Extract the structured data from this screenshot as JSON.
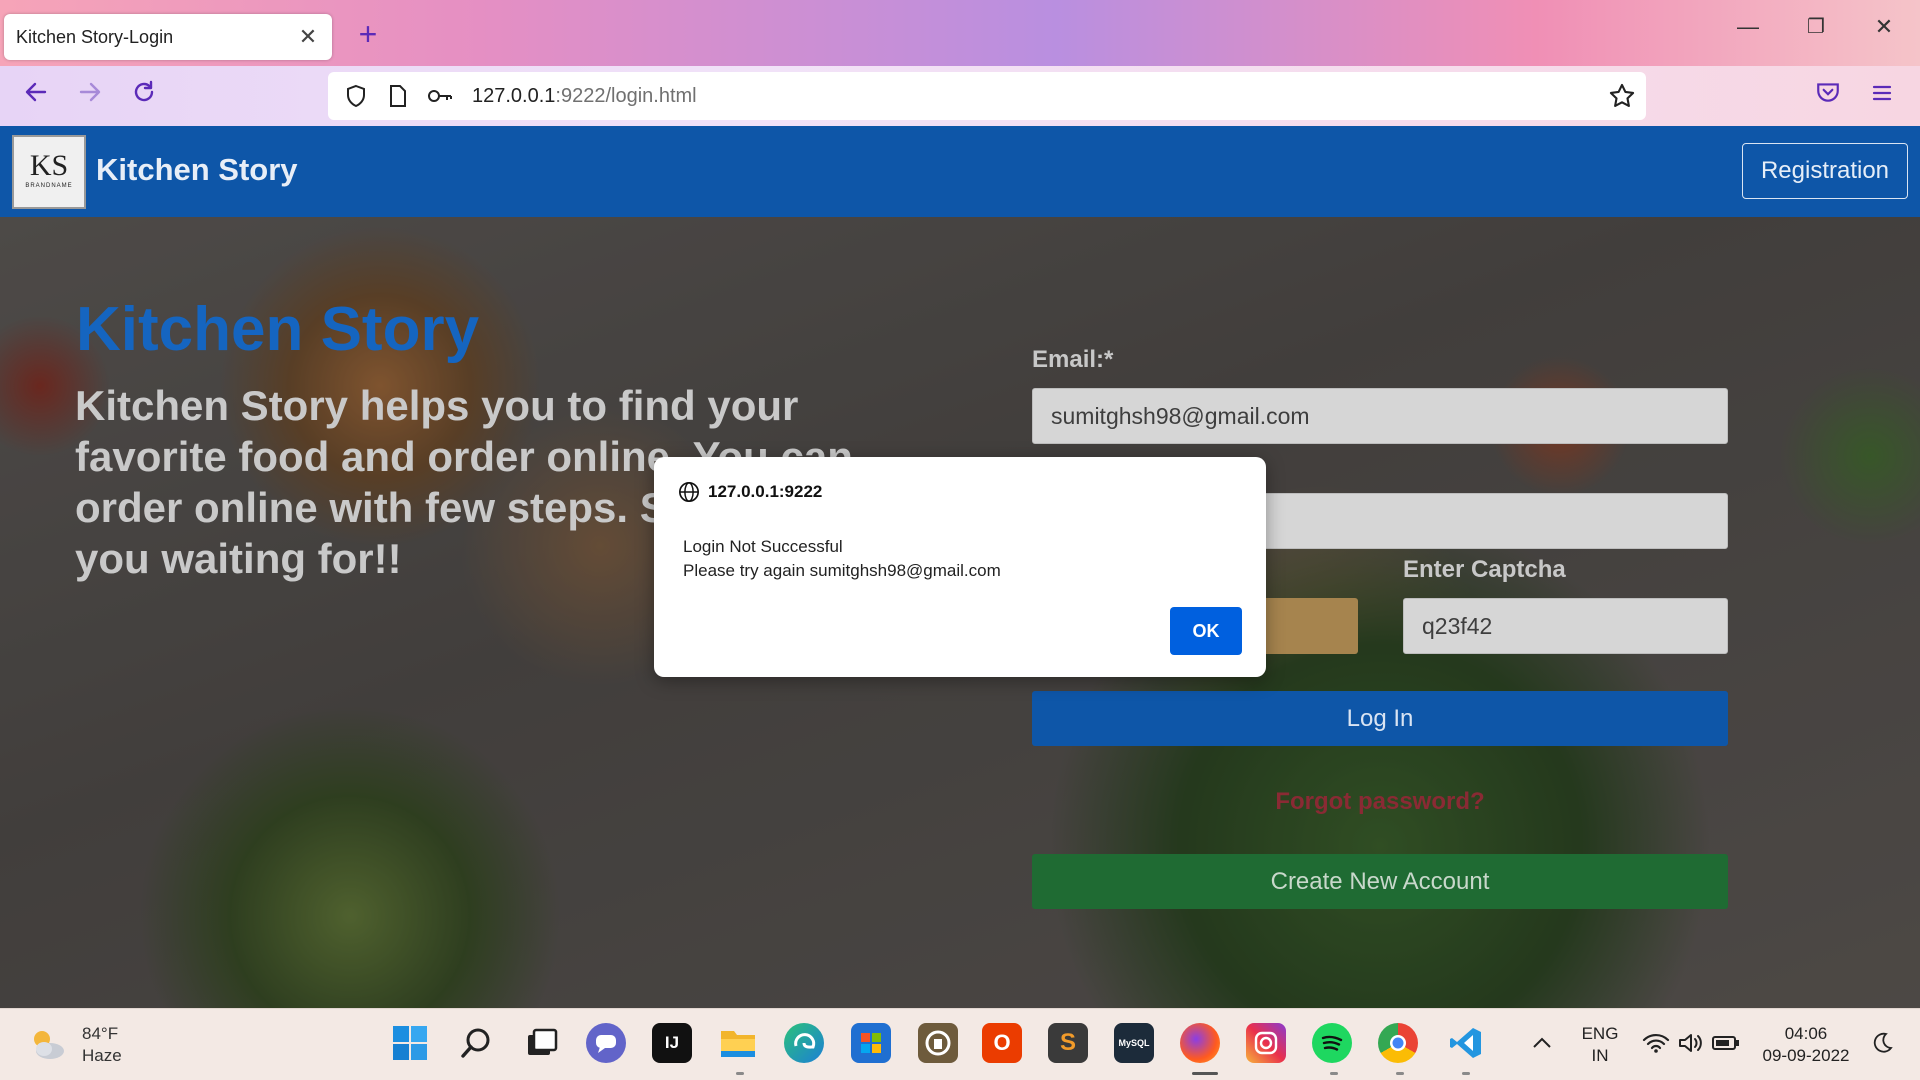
{
  "browser": {
    "tab_title": "Kitchen Story-Login",
    "close_glyph": "✕",
    "new_tab_glyph": "+",
    "url_host": "127.0.0.1",
    "url_path": ":9222/login.html",
    "window_minimize": "—",
    "window_restore": "❐",
    "window_close": "✕"
  },
  "header": {
    "logo_letters": "KS",
    "logo_sub": "BRANDNAME",
    "brand": "Kitchen Story",
    "registration_label": "Registration"
  },
  "hero": {
    "title": "Kitchen Story",
    "text": "Kitchen Story helps you to find your favorite food and order online. You can order online with few steps. So what are you waiting for!!"
  },
  "form": {
    "email_label": "Email:*",
    "email_value": "sumitghsh98@gmail.com",
    "captcha_label": "Enter Captcha",
    "captcha_value": "q23f42",
    "login_label": "Log In",
    "forgot_label": "Forgot password?",
    "create_label": "Create New Account"
  },
  "dialog": {
    "origin": "127.0.0.1:9222",
    "line1": "Login Not Successful",
    "line2": "Please try again sumitghsh98@gmail.com",
    "ok_label": "OK"
  },
  "taskbar": {
    "temperature": "84°F",
    "condition": "Haze",
    "language_top": "ENG",
    "language_bottom": "IN",
    "time": "04:06",
    "date": "09-09-2022",
    "apps": [
      "start",
      "search",
      "task-view",
      "teams-chat",
      "intellij",
      "file-explorer",
      "edge",
      "store",
      "app",
      "office",
      "sublime",
      "mysql",
      "firefox",
      "instagram",
      "spotify",
      "chrome",
      "vscode"
    ]
  },
  "colors": {
    "header_blue": "#0e56a8",
    "title_blue": "#1565c0",
    "ok_blue": "#0060df",
    "create_green": "#1f6b33",
    "forgot_red": "#8a2a34"
  }
}
